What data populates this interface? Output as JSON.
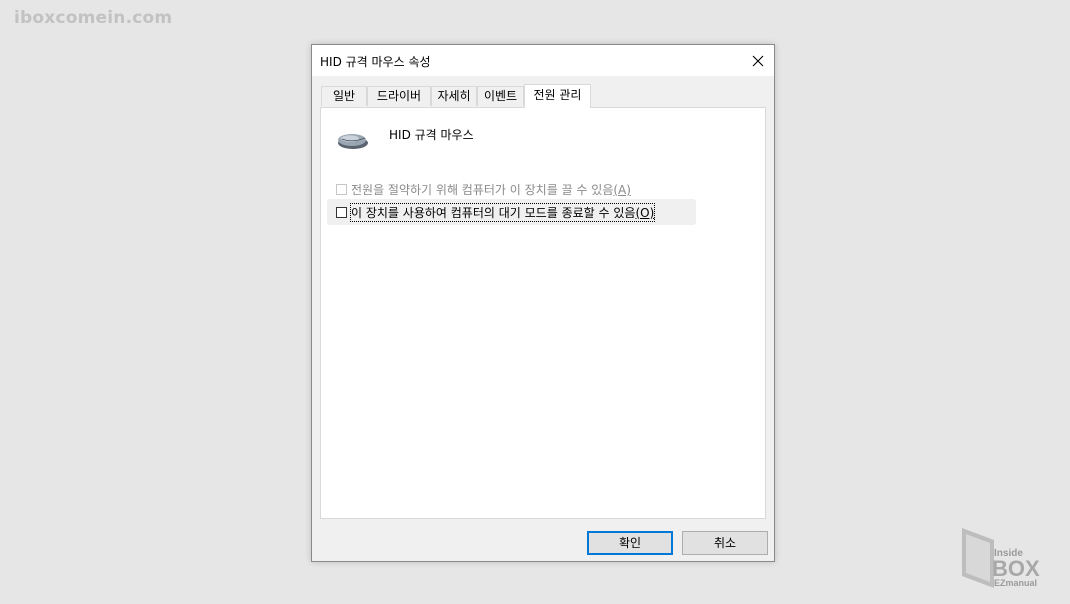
{
  "watermark": "iboxcomein.com",
  "dialog": {
    "title": "HID 규격 마우스 속성",
    "close_icon": "close-icon",
    "tabs": [
      {
        "label": "일반",
        "active": false
      },
      {
        "label": "드라이버",
        "active": false
      },
      {
        "label": "자세히",
        "active": false
      },
      {
        "label": "이벤트",
        "active": false
      },
      {
        "label": "전원 관리",
        "active": true
      }
    ],
    "device": {
      "icon": "mouse-icon",
      "name": "HID 규격 마우스"
    },
    "options": [
      {
        "label": "전원을 절약하기 위해 컴퓨터가 이 장치를 끌 수 있음",
        "accel": "(A)",
        "checked": false,
        "enabled": false
      },
      {
        "label": "이 장치를 사용하여 컴퓨터의 대기 모드를 종료할 수 있음",
        "accel": "(O)",
        "checked": false,
        "enabled": true
      }
    ],
    "buttons": {
      "ok": "확인",
      "cancel": "취소"
    }
  },
  "logo": {
    "line1": "Inside",
    "line2": "BOX",
    "line3": "EZmanual"
  }
}
